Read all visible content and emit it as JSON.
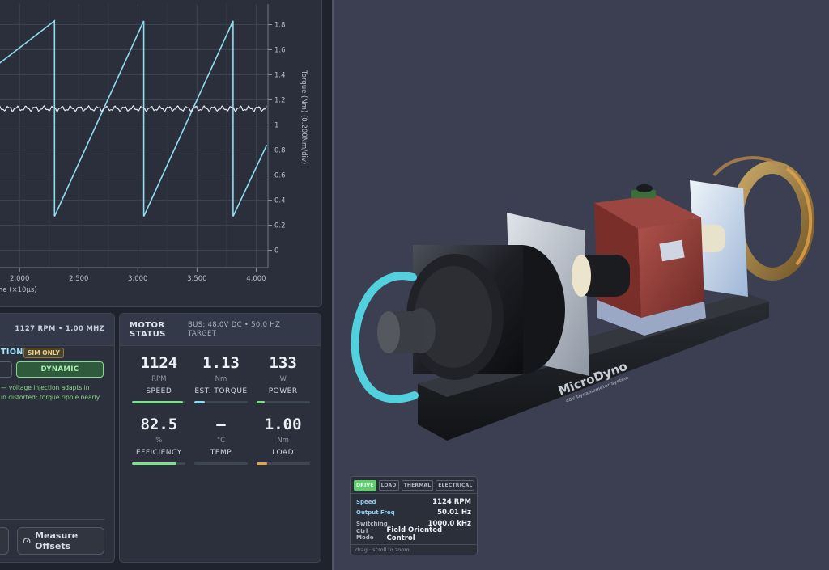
{
  "scope": {
    "x_axis_label": "me (×10µs)",
    "y_axis_label": "Torque (Nm) (0.200Nm/div)",
    "x_ticks": [
      "2,000",
      "2,500",
      "3,000",
      "3,500",
      "4,000"
    ],
    "y_ticks": [
      "1.8",
      "1.6",
      "1.4",
      "1.2",
      "1",
      "0.8",
      "0.6",
      "0.4",
      "0.2",
      "0"
    ],
    "colors": {
      "sawtooth": "#8fdcf0",
      "torque": "#e6ecf2",
      "grid": "#3c4250"
    }
  },
  "chart_data": {
    "type": "line",
    "title": "",
    "xlabel": "me (×10µs)",
    "ylabel": "Torque (Nm) (0.200Nm/div)",
    "xlim": [
      1800,
      4100
    ],
    "ylim": [
      -0.1,
      1.9
    ],
    "grid": true,
    "series": [
      {
        "x": [
          1800,
          2295,
          2295,
          3050,
          3050,
          3805,
          3805,
          4090
        ],
        "y": [
          1.47,
          1.83,
          0.27,
          1.83,
          0.27,
          1.83,
          0.27,
          0.84
        ]
      },
      {
        "x": [
          1800,
          4090
        ],
        "y": [
          1.13,
          1.13
        ],
        "ripple_amplitude": 0.015
      }
    ]
  },
  "left_card": {
    "header_info": "1127 RPM • 1.00 MHZ",
    "mode_label": "TION",
    "badge": "SIM ONLY",
    "dynamic_label": "DYNAMIC",
    "note_lines": [
      "— voltage injection adapts in",
      "in distorted; torque ripple nearly"
    ],
    "measure_button": "Measure Offsets"
  },
  "motor_status": {
    "title_line1": "MOTOR",
    "title_line2": "STATUS",
    "bus_line1": "BUS: 48.0V DC • 50.0 HZ",
    "bus_line2": "TARGET",
    "metrics": [
      {
        "value": "1124",
        "unit": "RPM",
        "label": "SPEED",
        "level": 0.95,
        "color": "#7ee08a"
      },
      {
        "value": "1.13",
        "unit": "Nm",
        "label": "EST. TORQUE",
        "level": 0.2,
        "color": "#8fdcf0"
      },
      {
        "value": "133",
        "unit": "W",
        "label": "POWER",
        "level": 0.15,
        "color": "#7ee08a"
      },
      {
        "value": "82.5",
        "unit": "%",
        "label": "EFFICIENCY",
        "level": 0.83,
        "color": "#7ee08a"
      },
      {
        "value": "—",
        "unit": "°C",
        "label": "TEMP",
        "level": 0,
        "color": "#7ee08a"
      },
      {
        "value": "1.00",
        "unit": "Nm",
        "label": "LOAD",
        "level": 0.2,
        "color": "#e6a54a"
      }
    ]
  },
  "viewport": {
    "brand": "MicroDyno",
    "brand_sub": "48V Dynamometer System",
    "info": {
      "tabs": [
        "DRIVE",
        "LOAD",
        "THERMAL",
        "ELECTRICAL"
      ],
      "active_tab": "DRIVE",
      "rows": [
        {
          "key": "Speed",
          "value": "1124 RPM"
        },
        {
          "key": "Output Freq",
          "value": "50.01 Hz"
        },
        {
          "key": "Switching",
          "value": "1000.0 kHz"
        },
        {
          "key": "Ctrl Mode",
          "value": "Field Oriented Control"
        }
      ],
      "footer": "drag · scroll to zoom"
    }
  }
}
